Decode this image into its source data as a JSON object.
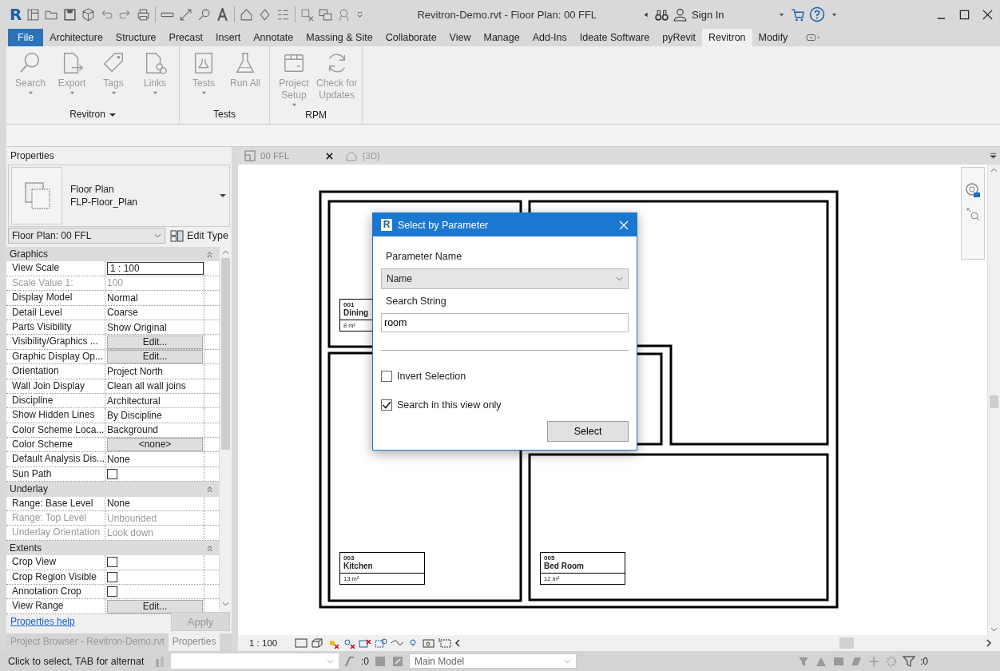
{
  "title_bar": {
    "app_logo": "R",
    "title": "Revitron-Demo.rvt - Floor Plan: 00 FFL",
    "sign_in": "Sign In"
  },
  "ribbon_tabs": [
    {
      "label": "File",
      "kind": "file",
      "selected": false
    },
    {
      "label": "Architecture",
      "kind": "tab",
      "selected": false
    },
    {
      "label": "Structure",
      "kind": "tab",
      "selected": false
    },
    {
      "label": "Precast",
      "kind": "tab",
      "selected": false
    },
    {
      "label": "Insert",
      "kind": "tab",
      "selected": false
    },
    {
      "label": "Annotate",
      "kind": "tab",
      "selected": false
    },
    {
      "label": "Massing & Site",
      "kind": "tab",
      "selected": false
    },
    {
      "label": "Collaborate",
      "kind": "tab",
      "selected": false
    },
    {
      "label": "View",
      "kind": "tab",
      "selected": false
    },
    {
      "label": "Manage",
      "kind": "tab",
      "selected": false
    },
    {
      "label": "Add-Ins",
      "kind": "tab",
      "selected": false
    },
    {
      "label": "Ideate Software",
      "kind": "tab",
      "selected": false
    },
    {
      "label": "pyRevit",
      "kind": "tab",
      "selected": false
    },
    {
      "label": "Revitron",
      "kind": "tab",
      "selected": true
    },
    {
      "label": "Modify",
      "kind": "tab",
      "selected": false
    }
  ],
  "ribbon_panels": [
    {
      "title": "Revitron",
      "has_menu": true,
      "buttons": [
        {
          "label": "Search",
          "kind": "search",
          "disabled": true,
          "has_menu": true
        },
        {
          "label": "Export",
          "kind": "export",
          "disabled": true,
          "has_menu": true
        },
        {
          "label": "Tags",
          "kind": "tags",
          "disabled": true,
          "has_menu": true
        },
        {
          "label": "Links",
          "kind": "links",
          "disabled": true,
          "has_menu": true
        }
      ]
    },
    {
      "title": "Tests",
      "has_menu": false,
      "buttons": [
        {
          "label": "Tests",
          "kind": "tests",
          "disabled": true,
          "has_menu": true
        },
        {
          "label": "Run All",
          "kind": "flask",
          "disabled": true,
          "has_menu": false
        }
      ]
    },
    {
      "title": "RPM",
      "has_menu": false,
      "buttons": [
        {
          "label": "Project\nSetup",
          "kind": "setup",
          "disabled": true,
          "has_menu": true
        },
        {
          "label": "Check for\nUpdates",
          "kind": "refresh",
          "disabled": true,
          "has_menu": false
        }
      ]
    }
  ],
  "properties": {
    "title": "Properties",
    "type_name": "Floor Plan",
    "type_sub": "FLP-Floor_Plan",
    "instance": "Floor Plan: 00 FFL",
    "edit_type": "Edit Type",
    "sections": [
      {
        "title": "Graphics",
        "expanded": true,
        "rows": [
          {
            "label": "View Scale",
            "value": "1 : 100",
            "kind": "input",
            "disabled": false
          },
          {
            "label": "Scale Value    1:",
            "value": "100",
            "kind": "text",
            "disabled": true
          },
          {
            "label": "Display Model",
            "value": "Normal",
            "kind": "text",
            "disabled": false
          },
          {
            "label": "Detail Level",
            "value": "Coarse",
            "kind": "text",
            "disabled": false
          },
          {
            "label": "Parts Visibility",
            "value": "Show Original",
            "kind": "text",
            "disabled": false
          },
          {
            "label": "Visibility/Graphics ...",
            "value": "Edit...",
            "kind": "button",
            "disabled": false
          },
          {
            "label": "Graphic Display Op...",
            "value": "Edit...",
            "kind": "button",
            "disabled": false
          },
          {
            "label": "Orientation",
            "value": "Project North",
            "kind": "text",
            "disabled": false
          },
          {
            "label": "Wall Join Display",
            "value": "Clean all wall joins",
            "kind": "text",
            "disabled": false
          },
          {
            "label": "Discipline",
            "value": "Architectural",
            "kind": "text",
            "disabled": false
          },
          {
            "label": "Show Hidden Lines",
            "value": "By Discipline",
            "kind": "text",
            "disabled": false
          },
          {
            "label": "Color Scheme Loca...",
            "value": "Background",
            "kind": "text",
            "disabled": false
          },
          {
            "label": "Color Scheme",
            "value": "<none>",
            "kind": "button",
            "disabled": false
          },
          {
            "label": "Default Analysis Dis...",
            "value": "None",
            "kind": "text",
            "disabled": false
          },
          {
            "label": "Sun Path",
            "kind": "checkbox",
            "checked": false,
            "disabled": false
          }
        ]
      },
      {
        "title": "Underlay",
        "expanded": true,
        "rows": [
          {
            "label": "Range: Base Level",
            "value": "None",
            "kind": "text",
            "disabled": false
          },
          {
            "label": "Range: Top Level",
            "value": "Unbounded",
            "kind": "text",
            "disabled": true
          },
          {
            "label": "Underlay Orientation",
            "value": "Look down",
            "kind": "text",
            "disabled": true
          }
        ]
      },
      {
        "title": "Extents",
        "expanded": true,
        "rows": [
          {
            "label": "Crop View",
            "kind": "checkbox",
            "checked": false,
            "disabled": false
          },
          {
            "label": "Crop Region Visible",
            "kind": "checkbox",
            "checked": false,
            "disabled": false
          },
          {
            "label": "Annotation Crop",
            "kind": "checkbox",
            "checked": false,
            "disabled": false
          },
          {
            "label": "View Range",
            "value": "Edit...",
            "kind": "button",
            "disabled": false
          }
        ]
      }
    ],
    "help_link": "Properties help",
    "apply": {
      "label": "Apply",
      "disabled": true
    }
  },
  "panel_tabs": [
    {
      "label": "Project Browser - Revitron-Demo.rvt",
      "selected": false
    },
    {
      "label": "Properties",
      "selected": true
    }
  ],
  "view_tabs": [
    {
      "label": "00 FFL",
      "kind": "plan",
      "selected": true
    },
    {
      "label": "{3D}",
      "kind": "model",
      "selected": false
    }
  ],
  "rooms": [
    {
      "number": "001",
      "name": "Dining",
      "area": "8 m²"
    },
    {
      "number": "003",
      "name": "Kitchen",
      "area": "13 m²"
    },
    {
      "number": "005",
      "name": "Bed Room",
      "area": "12 m²"
    }
  ],
  "dialog": {
    "logo": "R",
    "title": "Select by Parameter",
    "parameter_label": "Parameter Name",
    "parameter_value": "Name",
    "search_label": "Search String",
    "search_value": "room",
    "options": [
      {
        "label": "Invert Selection",
        "checked": false
      },
      {
        "label": "Search in this view only",
        "checked": true
      }
    ],
    "button": "Select"
  },
  "view_scale": "1 : 100",
  "status_bar": {
    "message": "Click to select, TAB for alternat",
    "worksets_count": ":0",
    "model": "Main Model",
    "filter_count": ":0"
  }
}
